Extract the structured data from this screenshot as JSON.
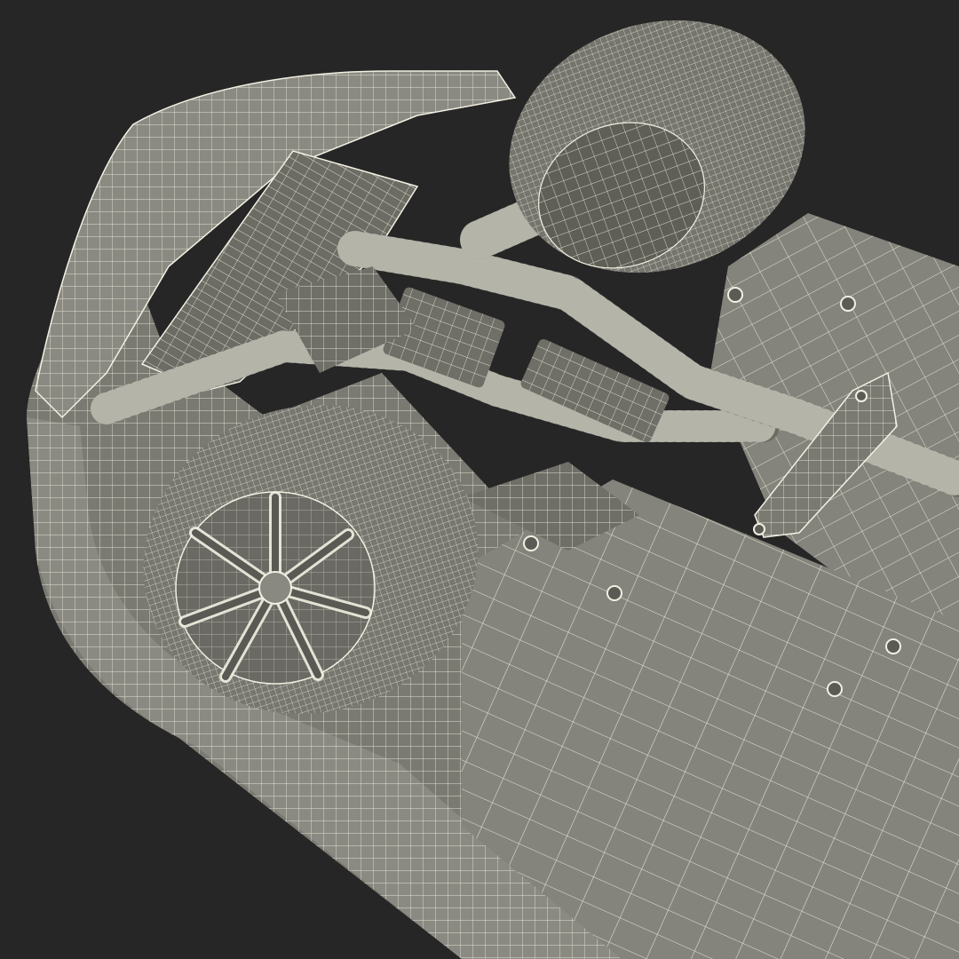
{
  "scene": {
    "background": "#262626",
    "shell_fill": "#7b7a72",
    "shell_fill_light": "#8b8a82",
    "shell_fill_dark": "#5f5e57",
    "wire_color": "#f2f0e2",
    "subject": "car-undercarriage-wireframe"
  }
}
